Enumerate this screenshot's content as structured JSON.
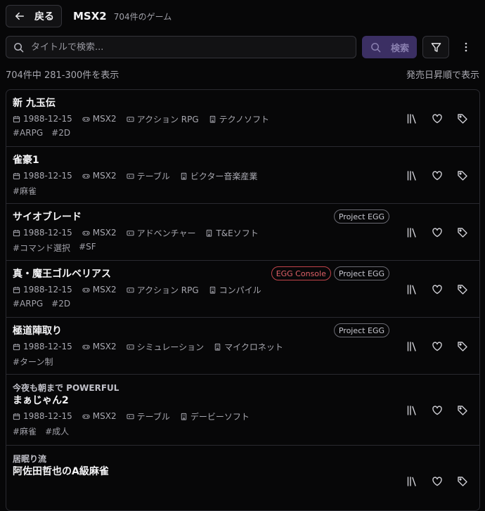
{
  "header": {
    "back_label": "戻る",
    "platform": "MSX2",
    "count_label": "704件のゲーム"
  },
  "search": {
    "placeholder": "タイトルで検索...",
    "button_label": "検索"
  },
  "results": {
    "info": "704件中 281-300件を表示",
    "sort": "発売日昇順で表示"
  },
  "colors": {
    "accent": "#3b2f63",
    "badge_red": "#c2444a"
  },
  "games": [
    {
      "subtitle": "",
      "title": "新 九玉伝",
      "date": "1988-12-15",
      "platform": "MSX2",
      "genre": "アクション RPG",
      "publisher": "テクノソフト",
      "tags": [
        "#ARPG",
        "#2D"
      ],
      "badges": []
    },
    {
      "subtitle": "",
      "title": "雀豪1",
      "date": "1988-12-15",
      "platform": "MSX2",
      "genre": "テーブル",
      "publisher": "ビクター音楽産業",
      "tags": [
        "#麻雀"
      ],
      "badges": []
    },
    {
      "subtitle": "",
      "title": "サイオブレード",
      "date": "1988-12-15",
      "platform": "MSX2",
      "genre": "アドベンチャー",
      "publisher": "T&Eソフト",
      "tags": [
        "#コマンド選択",
        "#SF"
      ],
      "badges": [
        {
          "label": "Project EGG",
          "red": false
        }
      ]
    },
    {
      "subtitle": "",
      "title": "真・魔王ゴルベリアス",
      "date": "1988-12-15",
      "platform": "MSX2",
      "genre": "アクション RPG",
      "publisher": "コンパイル",
      "tags": [
        "#ARPG",
        "#2D"
      ],
      "badges": [
        {
          "label": "EGG Console",
          "red": true
        },
        {
          "label": "Project EGG",
          "red": false
        }
      ]
    },
    {
      "subtitle": "",
      "title": "極道陣取り",
      "date": "1988-12-15",
      "platform": "MSX2",
      "genre": "シミュレーション",
      "publisher": "マイクロネット",
      "tags": [
        "#ターン制"
      ],
      "badges": [
        {
          "label": "Project EGG",
          "red": false
        }
      ]
    },
    {
      "subtitle": "今夜も朝まで POWERFUL",
      "title": "まぁじゃん2",
      "date": "1988-12-15",
      "platform": "MSX2",
      "genre": "テーブル",
      "publisher": "デービーソフト",
      "tags": [
        "#麻雀",
        "#成人"
      ],
      "badges": []
    },
    {
      "subtitle": "居眠り流",
      "title": "阿佐田哲也のA級麻雀",
      "date": "",
      "platform": "",
      "genre": "",
      "publisher": "",
      "tags": [],
      "badges": []
    }
  ]
}
